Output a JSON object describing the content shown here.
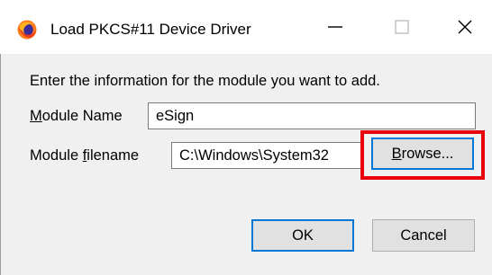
{
  "window": {
    "title": "Load PKCS#11 Device Driver",
    "controls": {
      "minimize_icon": "minimize-icon",
      "maximize_icon": "maximize-icon",
      "close_icon": "close-icon"
    }
  },
  "dialog": {
    "intro": "Enter the information for the module you want to add.",
    "module_name": {
      "label_mnemonic": "M",
      "label_rest": "odule Name",
      "value": "eSign"
    },
    "module_filename": {
      "label_before": "Module ",
      "label_mnemonic": "f",
      "label_after": "ilename",
      "value": "C:\\Windows\\System32"
    },
    "browse": {
      "label_mnemonic": "B",
      "label_rest": "rowse..."
    },
    "ok_label": "OK",
    "cancel_label": "Cancel"
  },
  "colors": {
    "highlight_box": "#e8000c",
    "focus_border": "#0078d7",
    "dialog_background": "#f0f0f0"
  }
}
